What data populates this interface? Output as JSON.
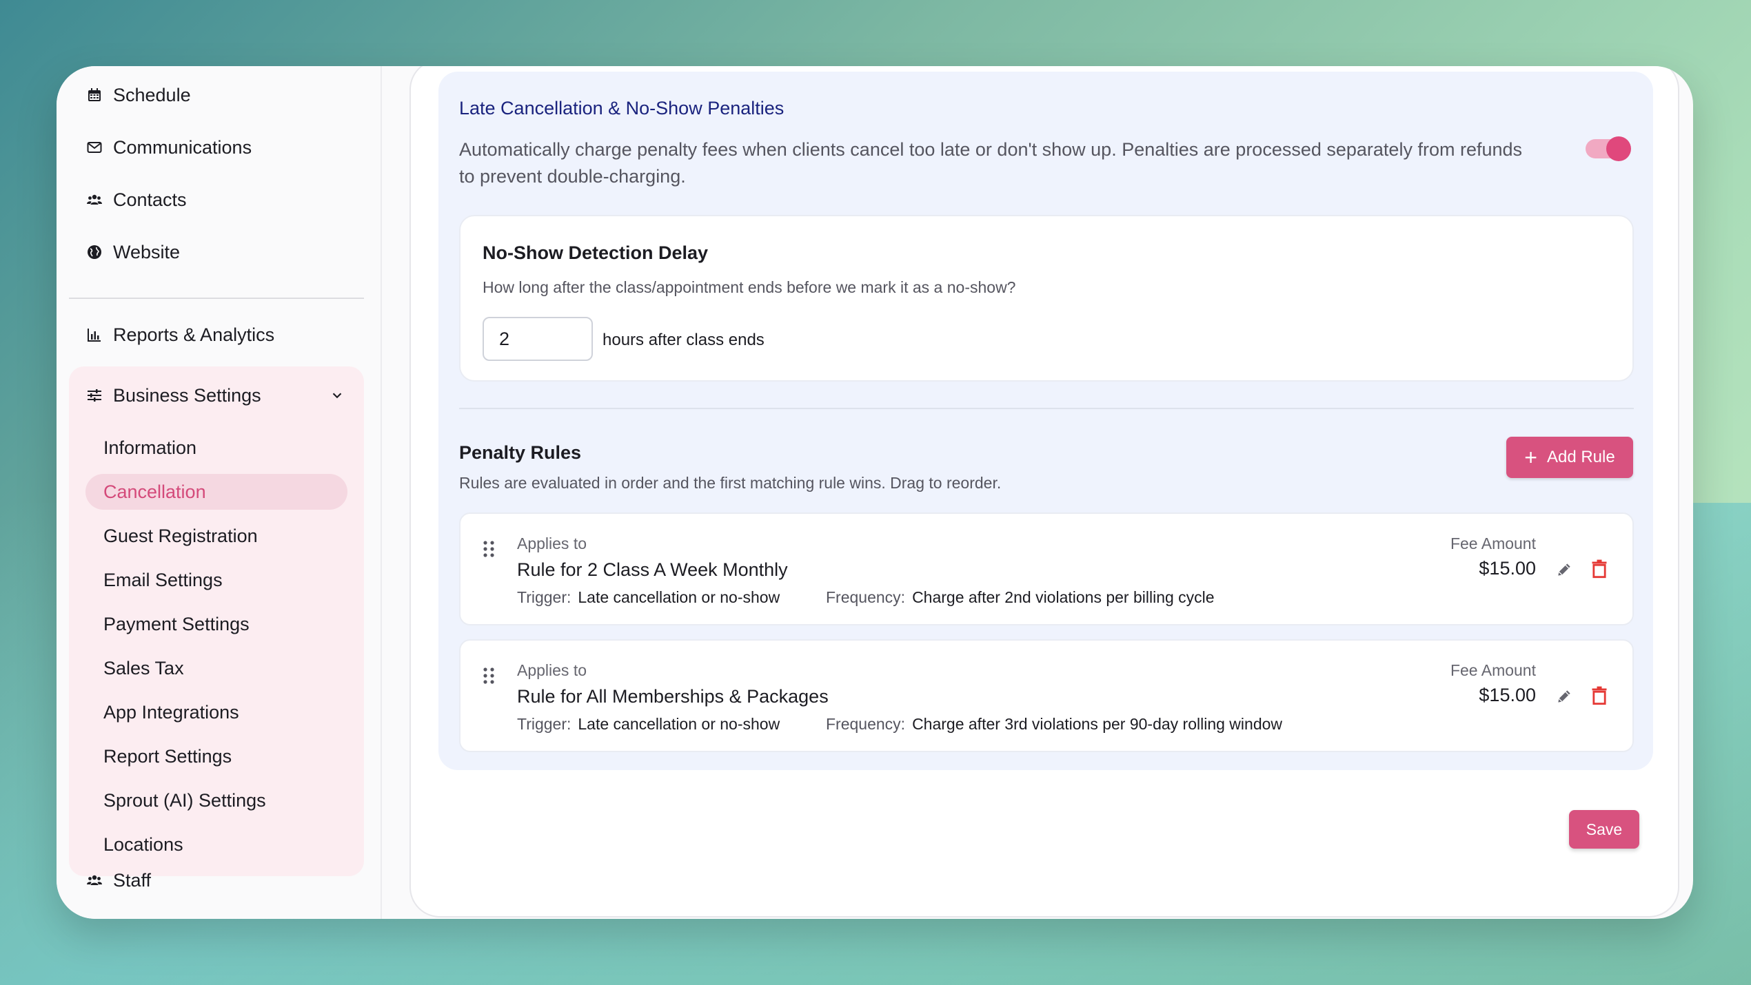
{
  "sidebar": {
    "items_top": [
      {
        "label": "Schedule",
        "icon": "calendar-icon"
      },
      {
        "label": "Communications",
        "icon": "mail-icon"
      },
      {
        "label": "Contacts",
        "icon": "people-icon"
      },
      {
        "label": "Website",
        "icon": "globe-icon"
      }
    ],
    "reports": {
      "label": "Reports & Analytics",
      "icon": "bar-chart-icon"
    },
    "business_settings": {
      "label": "Business Settings",
      "icon": "sliders-icon",
      "expanded": true,
      "items": [
        {
          "label": "Information"
        },
        {
          "label": "Cancellation",
          "active": true
        },
        {
          "label": "Guest Registration"
        },
        {
          "label": "Email Settings"
        },
        {
          "label": "Payment Settings"
        },
        {
          "label": "Sales Tax"
        },
        {
          "label": "App Integrations"
        },
        {
          "label": "Report Settings"
        },
        {
          "label": "Sprout (AI) Settings"
        },
        {
          "label": "Locations"
        }
      ]
    },
    "staff": {
      "label": "Staff",
      "icon": "people-icon"
    }
  },
  "penalties": {
    "title": "Late Cancellation & No-Show Penalties",
    "description": "Automatically charge penalty fees when clients cancel too late or don't show up. Penalties are processed separately from refunds to prevent double-charging.",
    "enabled": true
  },
  "no_show": {
    "title": "No-Show Detection Delay",
    "description": "How long after the class/appointment ends before we mark it as a no-show?",
    "value": "2",
    "unit": "hours after class ends"
  },
  "rules": {
    "title": "Penalty Rules",
    "description": "Rules are evaluated in order and the first matching rule wins. Drag to reorder.",
    "add_label": "Add Rule",
    "applies_label": "Applies to",
    "trigger_label": "Trigger:",
    "frequency_label": "Frequency:",
    "fee_label": "Fee Amount",
    "items": [
      {
        "name": "Rule for 2 Class A Week Monthly",
        "trigger": "Late cancellation or no-show",
        "frequency": "Charge after 2nd violations per billing cycle",
        "fee": "$15.00"
      },
      {
        "name": "Rule for All Memberships & Packages",
        "trigger": "Late cancellation or no-show",
        "frequency": "Charge after 3rd violations per 90-day rolling window",
        "fee": "$15.00"
      }
    ]
  },
  "save_label": "Save",
  "colors": {
    "accent": "#d8527f",
    "title_blue": "#1a237e",
    "section_bg": "#eff3fd",
    "active_bg": "#f5d8e1"
  }
}
